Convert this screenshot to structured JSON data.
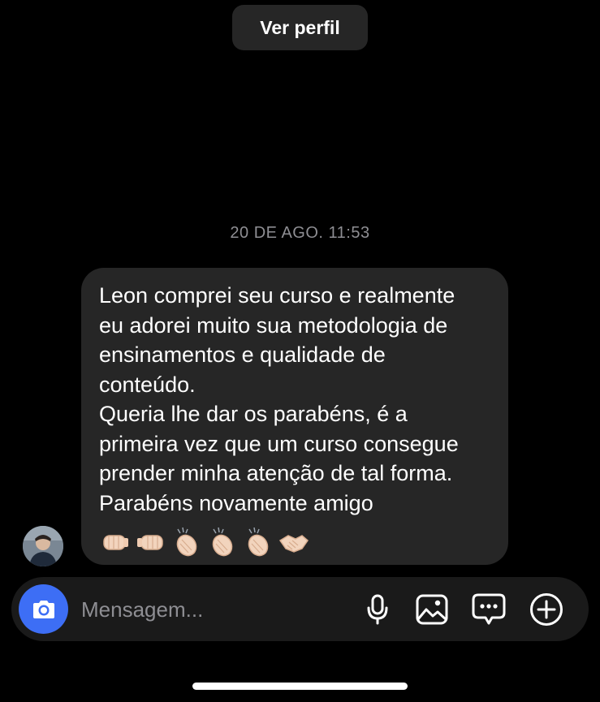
{
  "header": {
    "view_profile_label": "Ver perfil"
  },
  "conversation": {
    "timestamp": "20 DE AGO. 11:53",
    "messages": [
      {
        "lines": [
          "Leon comprei seu curso e realmente",
          "eu adorei muito sua metodologia de",
          "ensinamentos e qualidade de",
          "conteúdo.",
          "Queria lhe dar os parabéns, é a",
          "primeira vez que um curso consegue",
          "prender minha atenção de tal forma.",
          "Parabéns novamente amigo"
        ],
        "emojis": [
          "left-facing-fist",
          "right-facing-fist",
          "clapping-hands",
          "clapping-hands",
          "clapping-hands",
          "handshake"
        ]
      }
    ]
  },
  "composer": {
    "placeholder": "Mensagem...",
    "icons": [
      "camera-icon",
      "microphone-icon",
      "image-icon",
      "sticker-chat-icon",
      "plus-icon"
    ]
  },
  "colors": {
    "background": "#000000",
    "bubble": "#262626",
    "composer": "#1a1a1a",
    "camera_button": "#3d6ef5",
    "secondary_text": "#8e8e93",
    "skin_tone": "#f2d4bd"
  }
}
